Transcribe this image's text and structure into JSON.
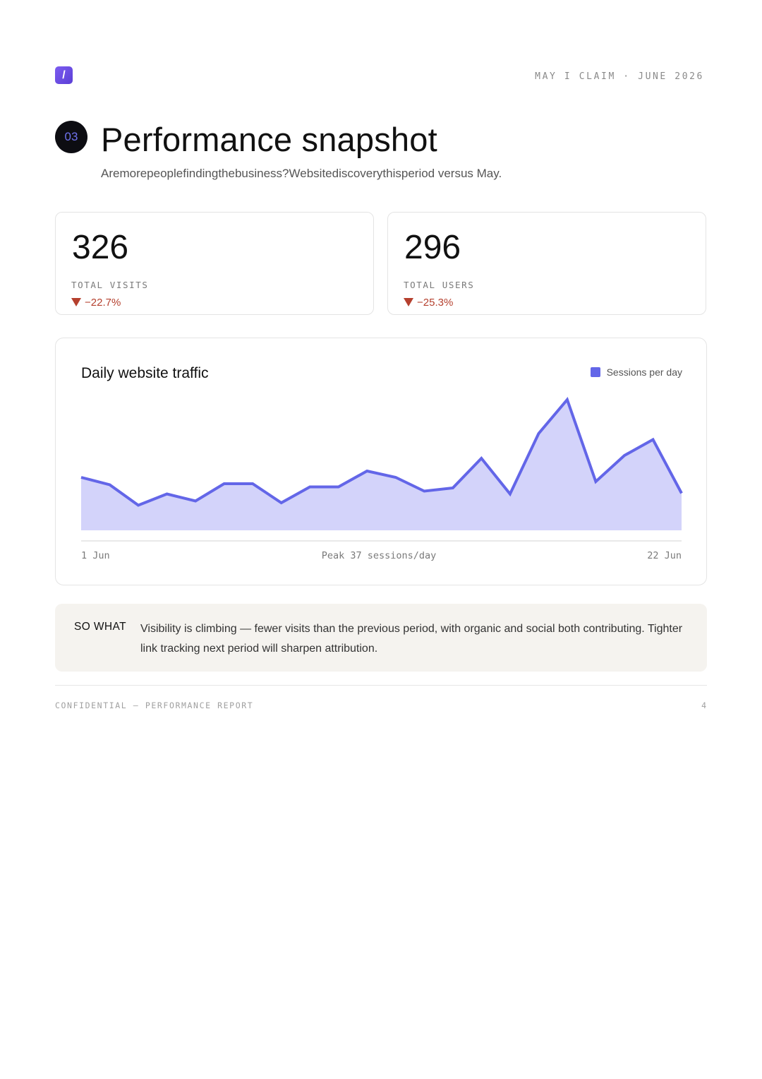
{
  "header": {
    "logo_glyph": "/",
    "brand": "MAY I CLAIM · JUNE 2026"
  },
  "section": {
    "number": "03",
    "title": "Performance snapshot",
    "subtitle": "Aremorepeoplefindingthebusiness?Websitediscoverythisperiod versus May."
  },
  "kpis": [
    {
      "value": "326",
      "label": "TOTAL VISITS",
      "delta": "−22.7%",
      "direction": "down"
    },
    {
      "value": "296",
      "label": "TOTAL USERS",
      "delta": "−25.3%",
      "direction": "down"
    }
  ],
  "chart_data": {
    "type": "area",
    "title": "Daily website traffic",
    "legend": "Sessions per day",
    "legend_position": "top-right",
    "x_start_label": "1 Jun",
    "x_end_label": "22 Jun",
    "peak_label": "Peak 37 sessions/day",
    "series": [
      {
        "name": "Sessions per day",
        "color": "#6366e8",
        "fill": "#d3d3fa",
        "values": [
          15,
          12.9,
          7.1,
          10.3,
          8.3,
          13.2,
          13.2,
          7.8,
          12.3,
          12.3,
          16.8,
          15,
          11.1,
          12,
          20.4,
          10.3,
          27.4,
          37,
          13.8,
          21.2,
          25.7,
          10.5
        ]
      }
    ],
    "ylim": [
      0,
      40
    ],
    "grid": false
  },
  "so_what": {
    "tag": "SO WHAT",
    "text": "Visibility is climbing — fewer visits than the previous period, with organic and social both contributing. Tighter link tracking next period will sharpen attribution."
  },
  "footer": {
    "left": "CONFIDENTIAL — PERFORMANCE REPORT",
    "page": "4"
  }
}
